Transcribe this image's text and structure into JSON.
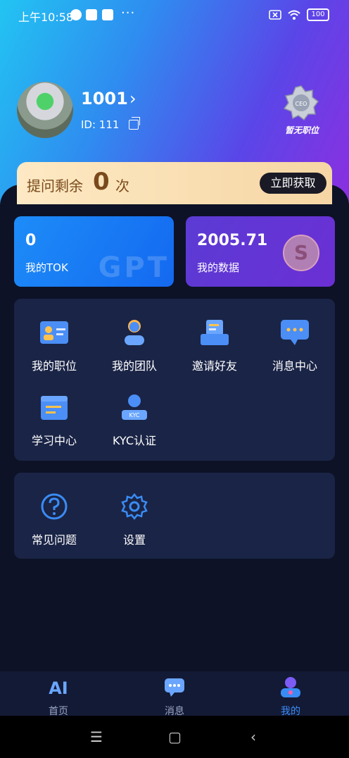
{
  "status": {
    "time": "上午10:58",
    "dots": "···",
    "battery": "100"
  },
  "profile": {
    "name": "1001",
    "id_label": "ID: 111",
    "position": "暂无职位",
    "badge_text": "CEO"
  },
  "quota": {
    "prefix": "提问剩余",
    "count": "0",
    "suffix": "次",
    "button": "立即获取"
  },
  "cards": {
    "tok_value": "0",
    "tok_label": "我的TOK",
    "tok_mark": "GPT",
    "data_value": "2005.71",
    "data_label": "我的数据",
    "coin_symbol": "S"
  },
  "menu": {
    "items": [
      "我的职位",
      "我的团队",
      "邀请好友",
      "消息中心",
      "学习中心",
      "KYC认证"
    ],
    "kyc_icon_text": "KYC"
  },
  "menu2": {
    "items": [
      "常见问题",
      "设置"
    ]
  },
  "nav": {
    "items": [
      "首页",
      "消息",
      "我的"
    ],
    "active": "我的",
    "ai_icon_text": "AI"
  },
  "system_nav": {
    "menu": "☰",
    "home": "▢",
    "back": "‹"
  },
  "colors": {
    "accent": "#3a8cf5",
    "gold": "#7a4a1c"
  }
}
